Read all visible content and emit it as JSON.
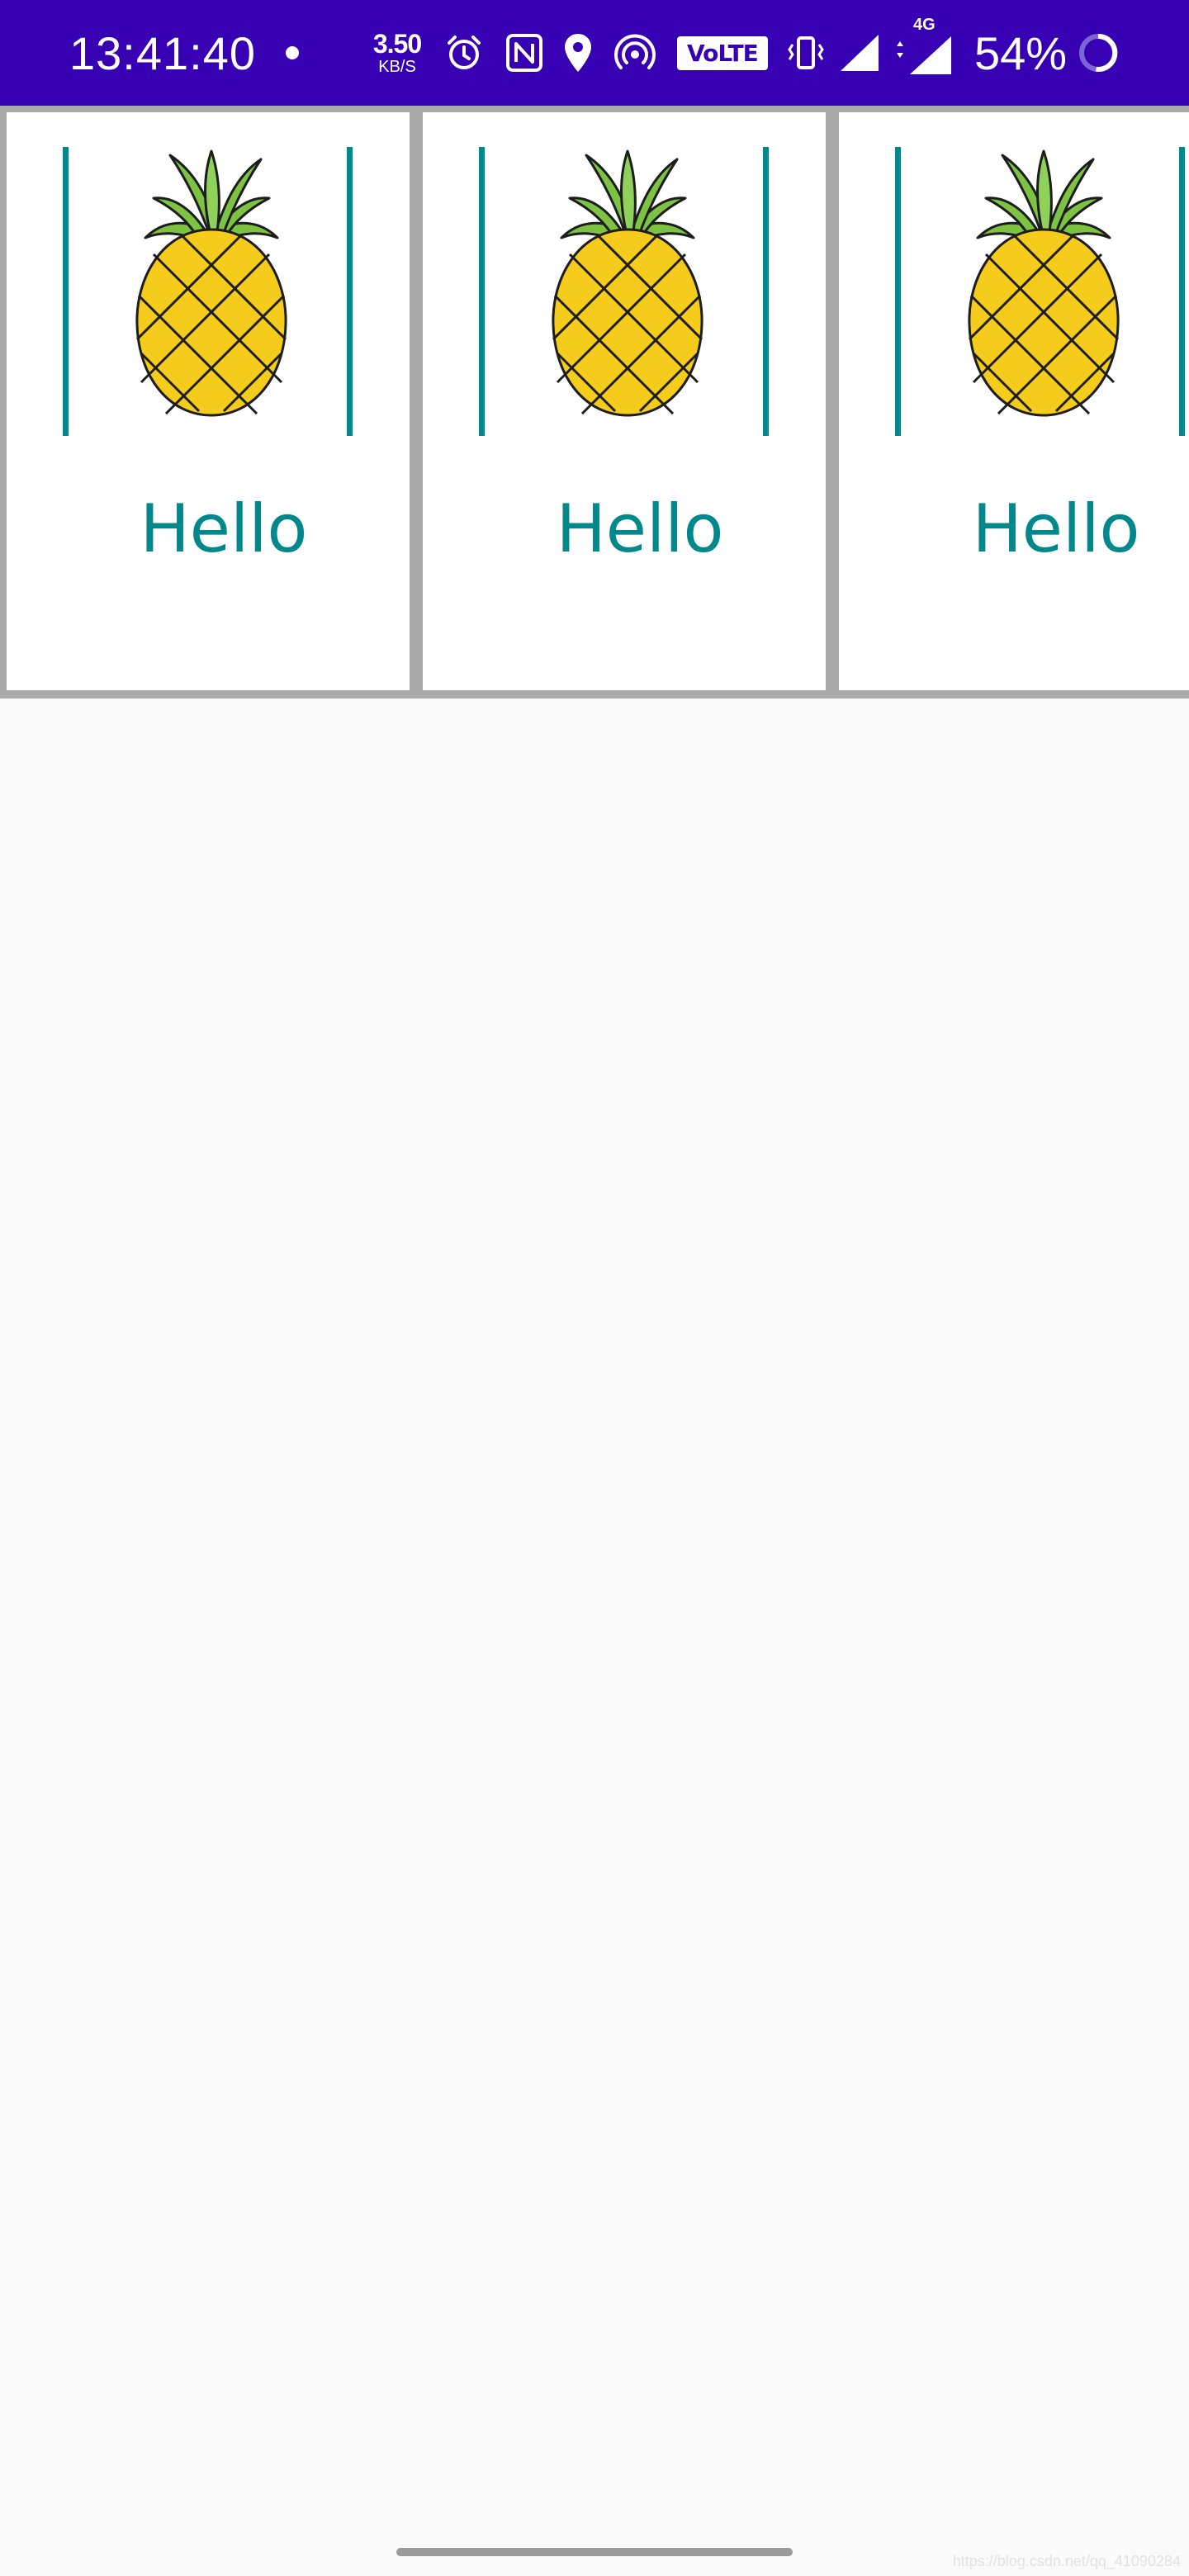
{
  "status_bar": {
    "time": "13:41:40",
    "net_speed_value": "3.50",
    "net_speed_unit": "KB/S",
    "volte": "VoLTE",
    "network_type": "4G",
    "battery": "54%",
    "background": "#3700b3"
  },
  "cards": [
    {
      "title": "Hello",
      "image": "pineapple"
    },
    {
      "title": "Hello",
      "image": "pineapple"
    },
    {
      "title": "Hello",
      "image": "pineapple"
    }
  ],
  "colors": {
    "accent": "#00888a",
    "strip_border": "#a9a9a9",
    "page_background": "#fafafa"
  },
  "watermark": "https://blog.csdn.net/qq_41090284"
}
